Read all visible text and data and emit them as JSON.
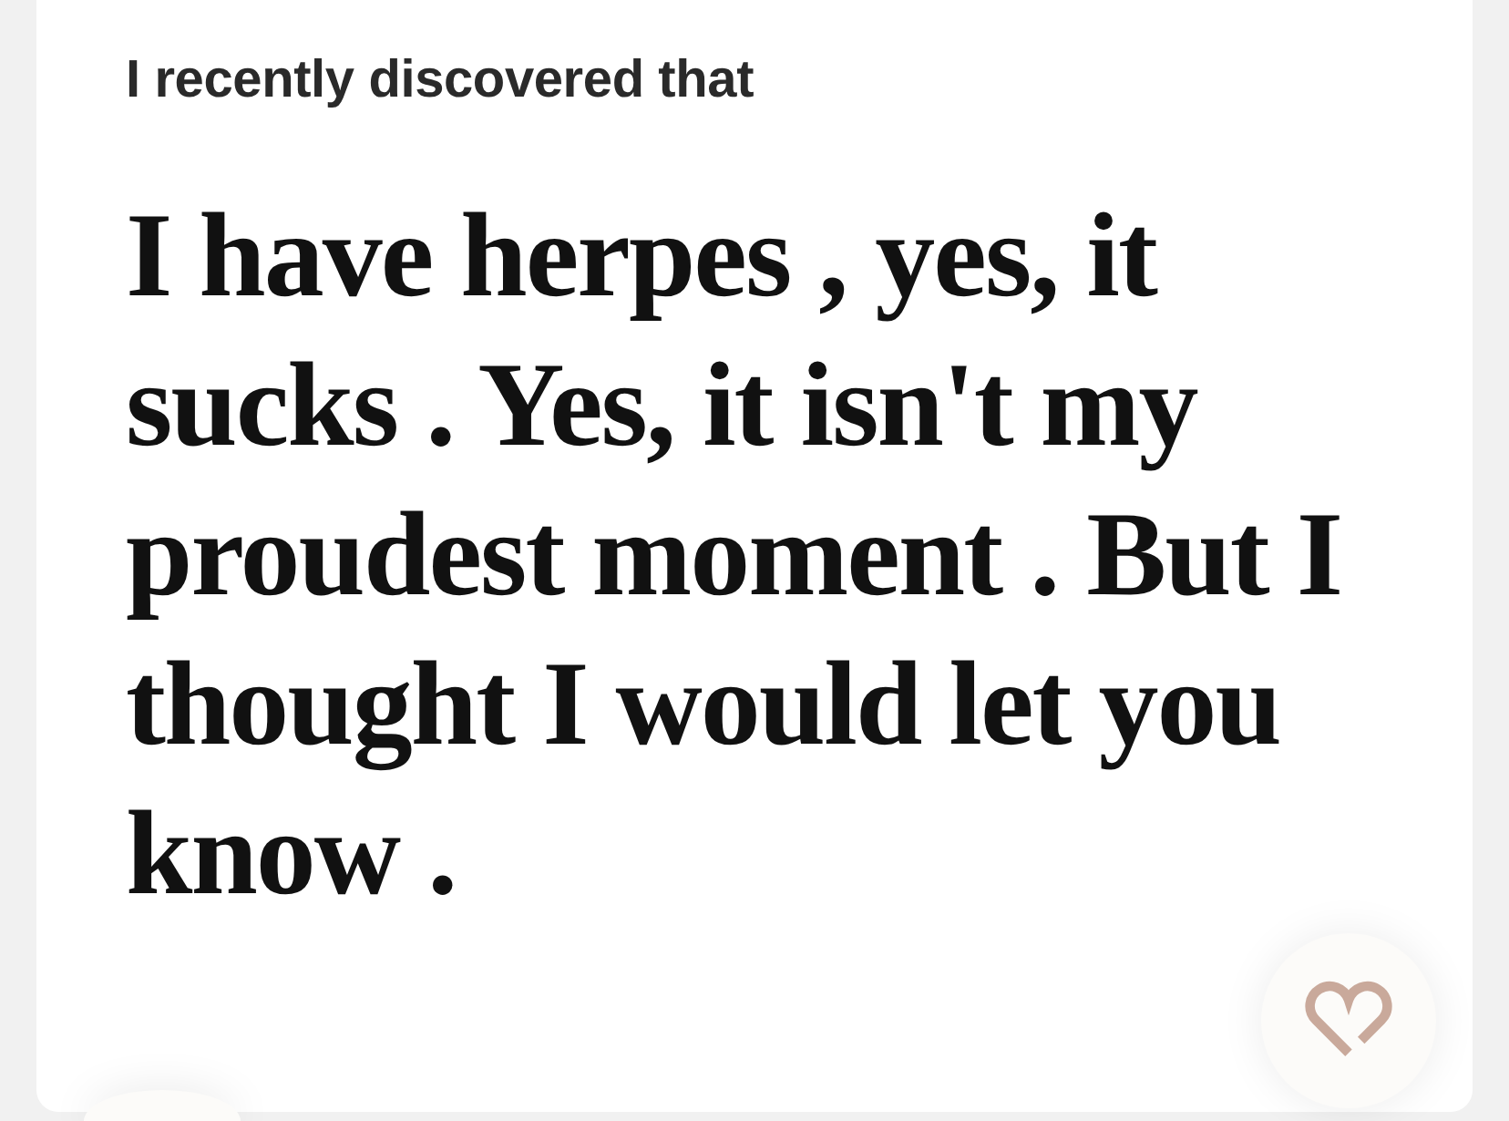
{
  "prompt": {
    "label": "I recently discovered that",
    "answer": "I have herpes , yes, it sucks . Yes, it isn't my proudest moment . But I thought I would let you know ."
  }
}
